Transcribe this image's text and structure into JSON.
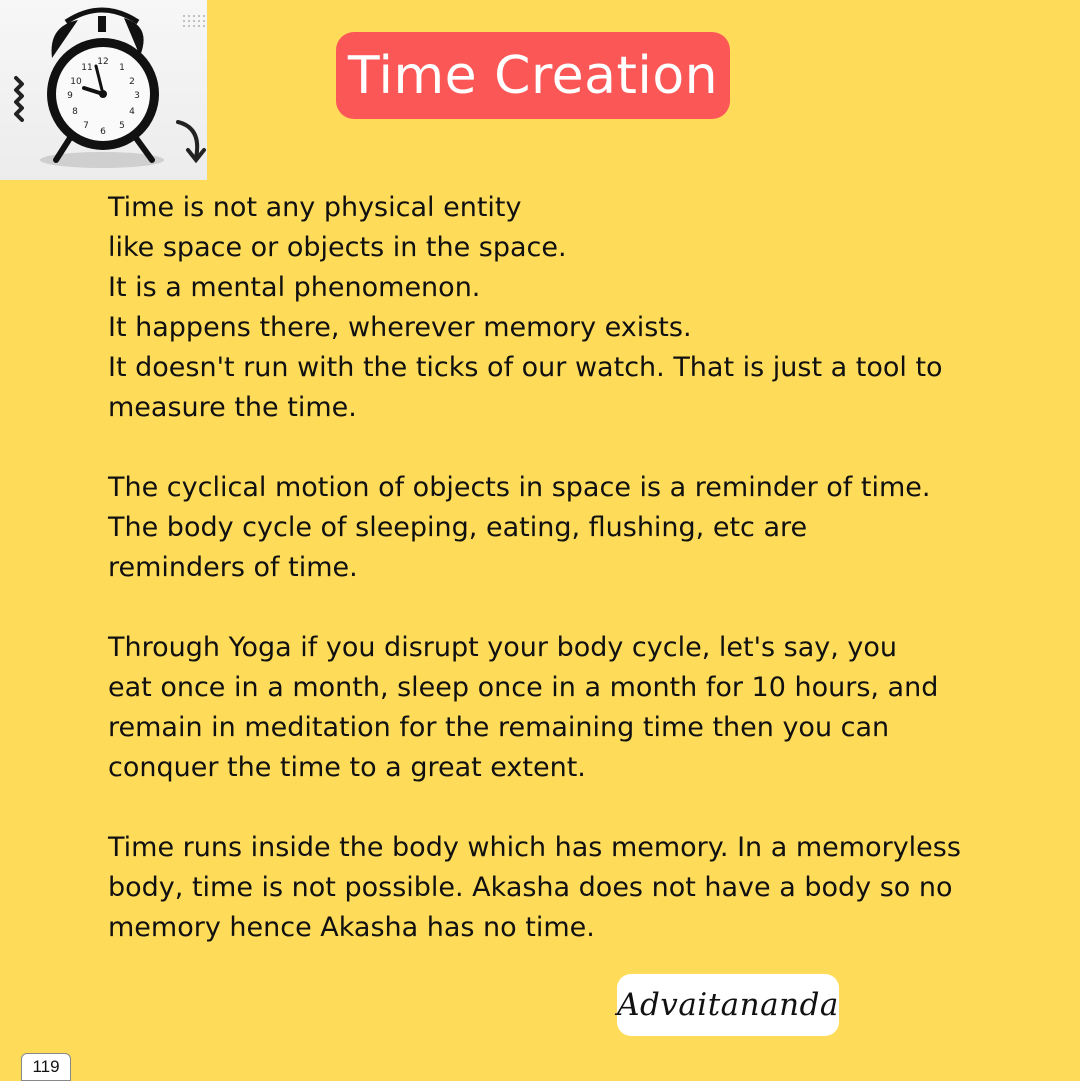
{
  "title": "Time Creation",
  "paragraphs": [
    [
      "Time is not any physical entity",
      "like space or objects in the space.",
      "It is a mental phenomenon.",
      "It happens there, wherever memory exists.",
      "It doesn't run with the ticks of our watch. That is just a tool to",
      "measure the time."
    ],
    [
      "The cyclical motion of objects in space is a reminder of time.",
      "The body cycle of sleeping, eating, flushing, etc are",
      "reminders of time."
    ],
    [
      "Through Yoga if you disrupt your body cycle, let's say, you",
      "eat once in a month, sleep once in a month for 10 hours, and",
      "remain in meditation for the remaining time then you can",
      "conquer the time to a great extent."
    ],
    [
      "Time runs inside the body which has memory. In a memoryless",
      "body, time is not possible. Akasha does not have a body so no",
      "memory hence Akasha has no time."
    ]
  ],
  "signature": "Advaitananda",
  "page_number": "119",
  "clock_numerals": [
    "12",
    "1",
    "2",
    "3",
    "4",
    "5",
    "6",
    "7",
    "8",
    "9",
    "10",
    "11"
  ],
  "colors": {
    "background": "#fedc5a",
    "title_pill": "#fc5757",
    "text": "#101010"
  },
  "icons": {
    "clock": "alarm-clock-icon",
    "arrow": "curved-arrow-icon",
    "zigzag": "zigzag-decoration"
  }
}
